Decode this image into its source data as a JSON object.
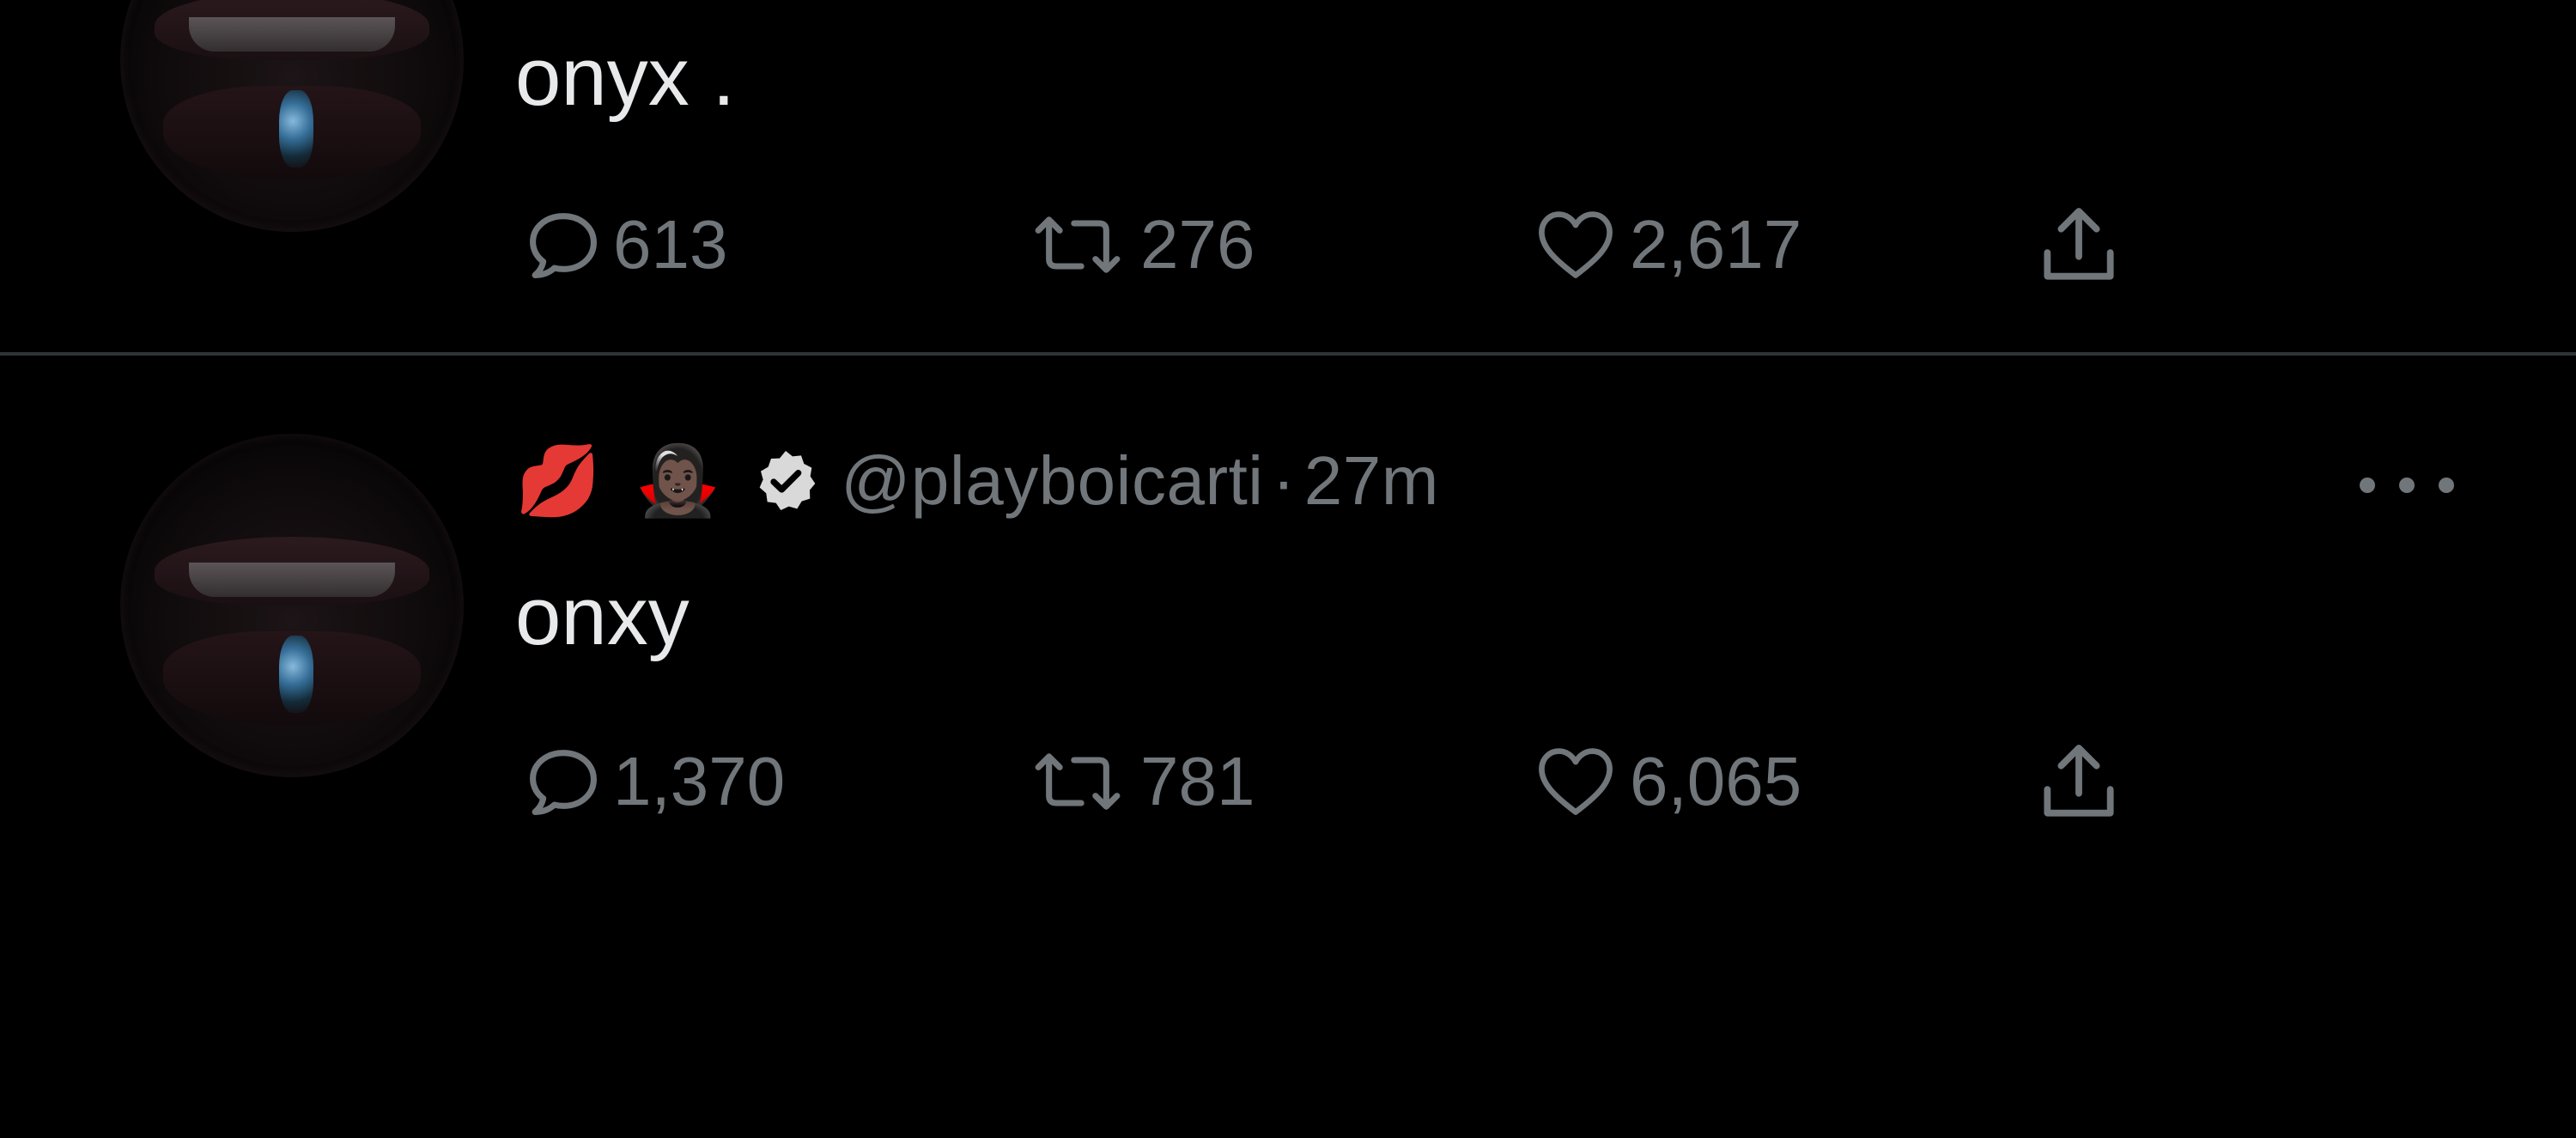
{
  "tweets": [
    {
      "text": "onyx .",
      "actions": {
        "replies": "613",
        "retweets": "276",
        "likes": "2,617"
      }
    },
    {
      "header": {
        "emoji_1": "💋",
        "emoji_2": "🧛🏿‍♀️",
        "handle": "@playboicarti",
        "separator": "·",
        "time": "27m"
      },
      "text": "onxy",
      "actions": {
        "replies": "1,370",
        "retweets": "781",
        "likes": "6,065"
      }
    }
  ],
  "icons": {
    "reply": "reply-icon",
    "retweet": "retweet-icon",
    "like": "heart-icon",
    "share": "share-icon",
    "verified": "verified-badge-icon",
    "more": "more-options-icon"
  },
  "colors": {
    "background": "#000000",
    "text": "#e7e9ea",
    "muted": "#71767b",
    "divider": "#2f3336"
  }
}
